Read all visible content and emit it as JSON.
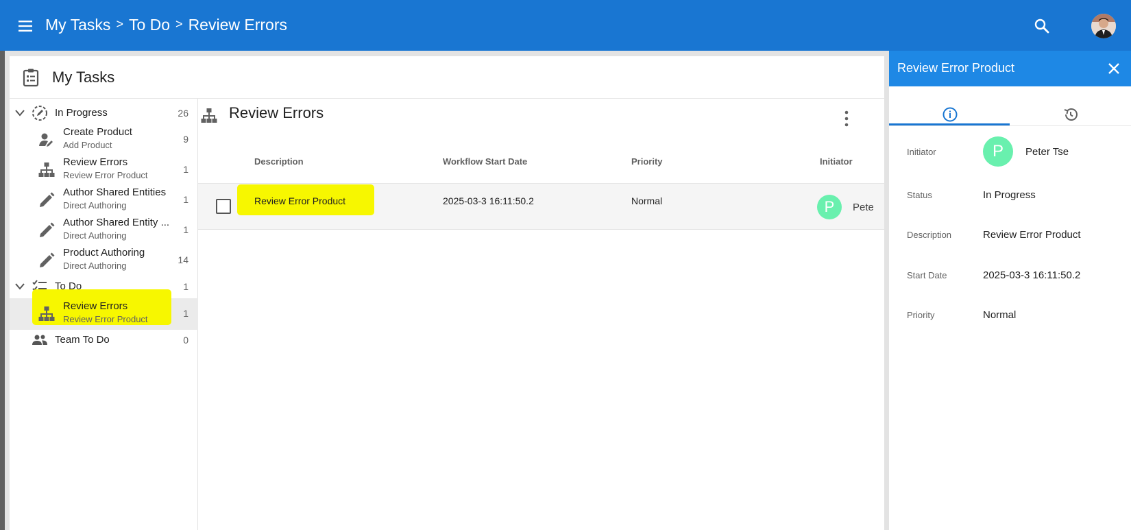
{
  "header": {
    "breadcrumb": [
      "My Tasks",
      "To Do",
      "Review Errors"
    ],
    "separator": ">"
  },
  "card": {
    "title": "My Tasks"
  },
  "sidebar": {
    "groups": [
      {
        "label": "In Progress",
        "count": "26",
        "items": [
          {
            "label": "Create Product",
            "sub": "Add Product",
            "count": "9",
            "icon": "person-edit-icon"
          },
          {
            "label": "Review Errors",
            "sub": "Review Error Product",
            "count": "1",
            "icon": "workflow-icon"
          },
          {
            "label": "Author Shared Entities",
            "sub": "Direct Authoring",
            "count": "1",
            "icon": "pencil-icon"
          },
          {
            "label": "Author Shared Entity ...",
            "sub": "Direct Authoring",
            "count": "1",
            "icon": "pencil-icon"
          },
          {
            "label": "Product Authoring",
            "sub": "Direct Authoring",
            "count": "14",
            "icon": "pencil-icon"
          }
        ]
      },
      {
        "label": "To Do",
        "count": "1",
        "items": [
          {
            "label": "Review Errors",
            "sub": "Review Error Product",
            "count": "1",
            "icon": "workflow-icon",
            "selected": true
          }
        ]
      },
      {
        "label": "Team To Do",
        "count": "0"
      }
    ]
  },
  "main": {
    "title": "Review Errors",
    "columns": [
      "Description",
      "Workflow Start Date",
      "Priority",
      "Initiator"
    ],
    "rows": [
      {
        "description": "Review Error Product",
        "start": "2025-03-3 16:11:50.2",
        "priority": "Normal",
        "initiator_letter": "P",
        "initiator": "Peter Tse"
      }
    ]
  },
  "detail": {
    "title": "Review Error Product",
    "fields": {
      "initiator_label": "Initiator",
      "initiator_letter": "P",
      "initiator": "Peter Tse",
      "status_label": "Status",
      "status": "In Progress",
      "description_label": "Description",
      "description": "Review Error Product",
      "start_label": "Start Date",
      "start": "2025-03-3 16:11:50.2",
      "priority_label": "Priority",
      "priority": "Normal"
    }
  },
  "colors": {
    "app_bar": "#1976d2",
    "panel_header": "#1e88e5",
    "avatar_green": "#69f0ae",
    "highlight": "#f7f700"
  }
}
